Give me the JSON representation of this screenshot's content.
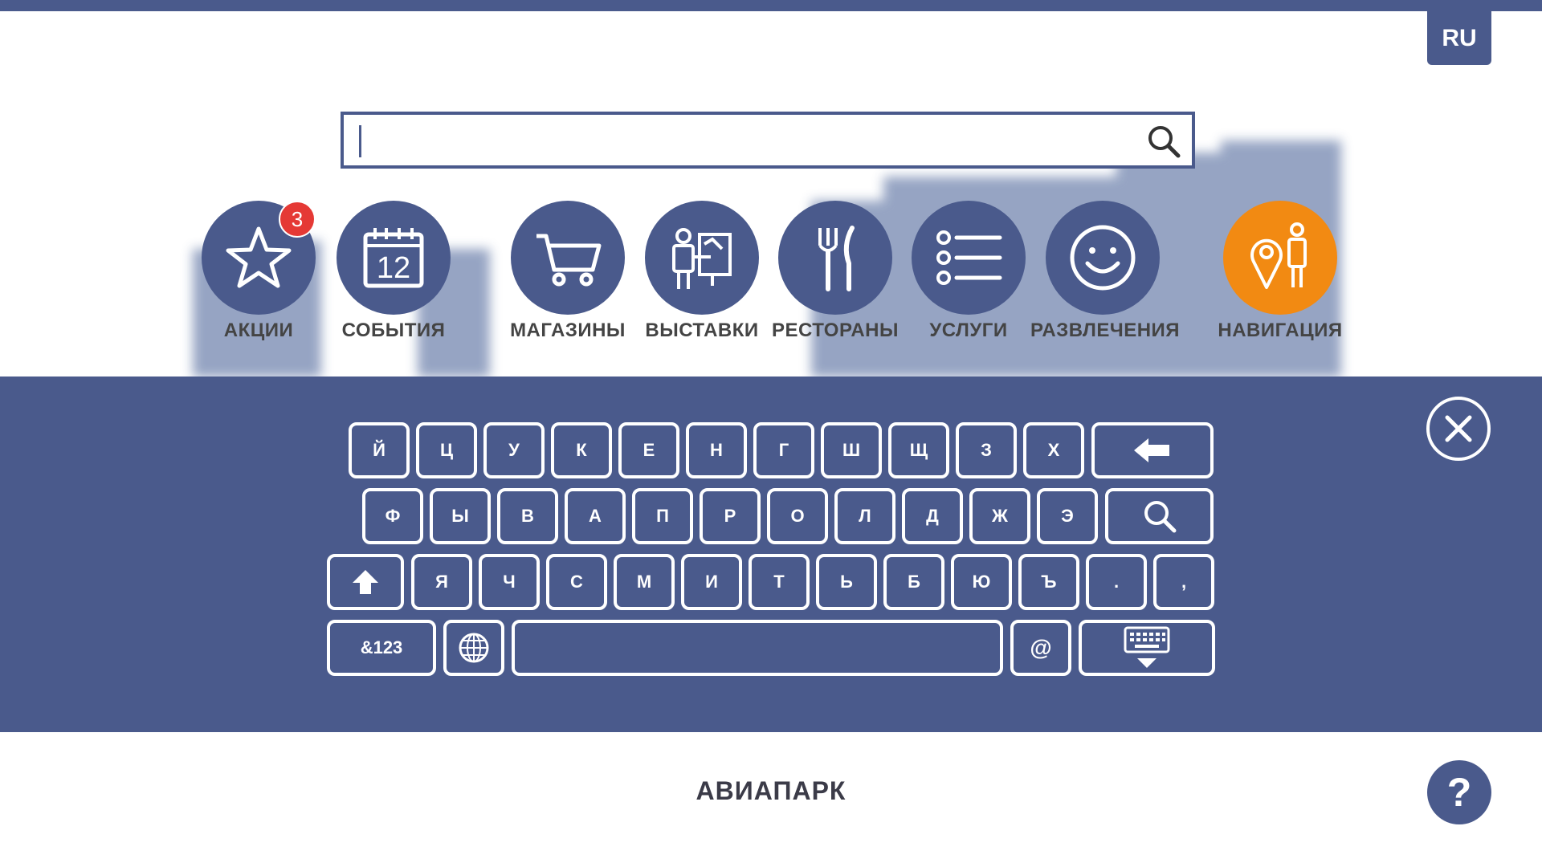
{
  "app": {
    "language_label": "RU",
    "mall_name": "АВИАПАРК"
  },
  "colors": {
    "primary": "#4a5a8c",
    "accent": "#f28a12",
    "badge": "#e53935"
  },
  "search": {
    "value": "",
    "placeholder": ""
  },
  "categories": [
    {
      "label": "АКЦИИ",
      "icon": "star-icon",
      "badge": "3"
    },
    {
      "label": "СОБЫТИЯ",
      "icon": "calendar-icon",
      "calendar_day": "12"
    },
    {
      "label": "МАГАЗИНЫ",
      "icon": "shopping-cart-icon"
    },
    {
      "label": "ВЫСТАВКИ",
      "icon": "exhibition-icon"
    },
    {
      "label": "РЕСТОРАНЫ",
      "icon": "fork-knife-icon"
    },
    {
      "label": "УСЛУГИ",
      "icon": "list-icon"
    },
    {
      "label": "РАЗВЛЕЧЕНИЯ",
      "icon": "smile-icon"
    },
    {
      "label": "НАВИГАЦИЯ",
      "icon": "navigation-pin-person-icon"
    }
  ],
  "keyboard": {
    "row1": [
      "Й",
      "Ц",
      "У",
      "К",
      "Е",
      "Н",
      "Г",
      "Ш",
      "Щ",
      "З",
      "Х"
    ],
    "row2": [
      "Ф",
      "Ы",
      "В",
      "А",
      "П",
      "Р",
      "О",
      "Л",
      "Д",
      "Ж",
      "Э"
    ],
    "row3": [
      "Я",
      "Ч",
      "С",
      "М",
      "И",
      "Т",
      "Ь",
      "Б",
      "Ю",
      "Ъ",
      ".",
      ","
    ],
    "symbols_label": "&123",
    "at_label": "@",
    "backspace_icon": "backspace-arrow-icon",
    "search_icon": "search-icon",
    "shift_icon": "shift-arrow-icon",
    "globe_icon": "globe-icon",
    "hide_icon": "keyboard-hide-icon"
  },
  "help_label": "?"
}
